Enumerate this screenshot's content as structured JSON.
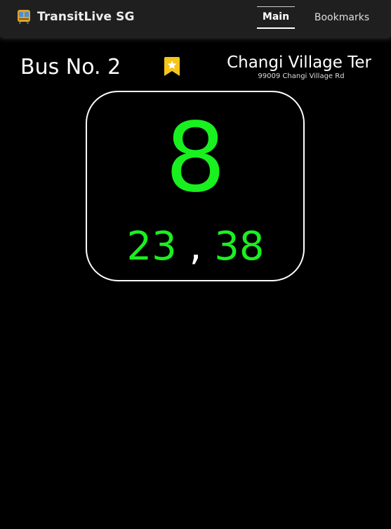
{
  "app": {
    "title": "TransitLive SG",
    "logo_icon": "bus-icon"
  },
  "nav": {
    "tabs": [
      {
        "label": "Main",
        "active": true
      },
      {
        "label": "Bookmarks",
        "active": false
      }
    ]
  },
  "service": {
    "bus_label": "Bus No. 2",
    "bookmark_icon": "star-bookmark-icon",
    "bookmark_color": "#f5c518"
  },
  "stop": {
    "name": "Changi Village Ter",
    "code_and_road": "99009 Changi Village Rd"
  },
  "arrival": {
    "next": "8",
    "subsequent": [
      "23",
      "38"
    ],
    "separator": ",",
    "color": "#19f01f"
  },
  "colors": {
    "background": "#000000",
    "navbar": "#1f1f1f",
    "text": "#ffffff",
    "arrival_green": "#19f01f"
  }
}
